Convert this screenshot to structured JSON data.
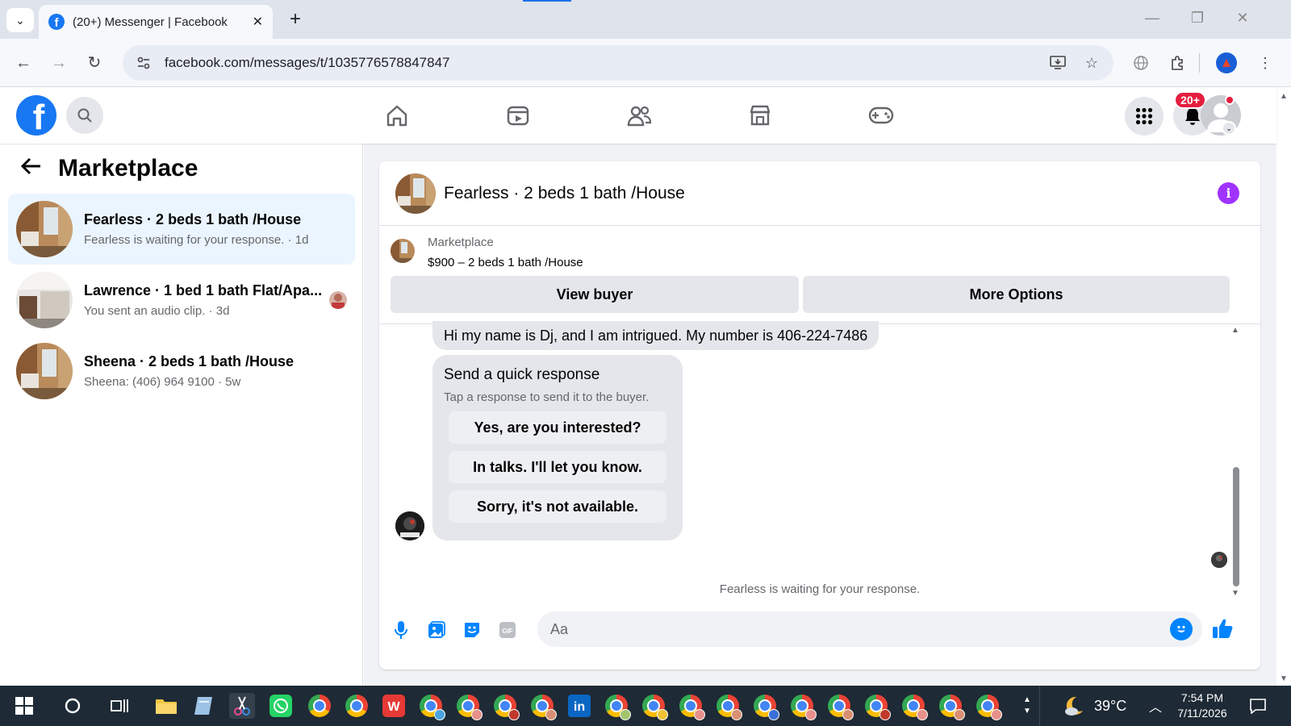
{
  "browser": {
    "tab_title": "(20+) Messenger | Facebook",
    "tab_close": "✕",
    "new_tab": "+",
    "url": "facebook.com/messages/t/1035776578847847"
  },
  "fb_header": {
    "notification_badge": "20+"
  },
  "left_panel": {
    "title": "Marketplace",
    "conversations": [
      {
        "name": "Fearless · 2 beds 1 bath /House",
        "preview": "Fearless is waiting for your response. · 1d"
      },
      {
        "name": "Lawrence · 1 bed 1 bath Flat/Apa...",
        "preview": "You sent an audio clip. · 3d"
      },
      {
        "name": "Sheena · 2 beds 1 bath /House",
        "preview": "Sheena: (406) 964 9100 · 5w"
      }
    ]
  },
  "chat": {
    "title": "Fearless · 2 beds 1 bath /House",
    "listing_label": "Marketplace",
    "listing_price": "$900 – 2 beds 1 bath /House",
    "view_buyer": "View buyer",
    "more_options": "More Options",
    "message": "Hi my name is Dj, and I am intrigued. My number is 406-224-7486",
    "quick_response": {
      "title": "Send a quick response",
      "subtitle": "Tap a response to send it to the buyer.",
      "options": [
        "Yes, are you interested?",
        "In talks. I'll let you know.",
        "Sorry, it's not available."
      ]
    },
    "waiting_note": "Fearless is waiting for your response.",
    "composer_placeholder": "Aa"
  },
  "taskbar": {
    "temperature": "39°C",
    "time": "7:54 PM",
    "date": "7/11/2026"
  },
  "colors": {
    "fb_blue": "#1877f2",
    "messenger_blue": "#0084ff",
    "active_conv": "#ebf5ff",
    "info_purple": "#a033ff",
    "badge_red": "#e41e3f"
  }
}
